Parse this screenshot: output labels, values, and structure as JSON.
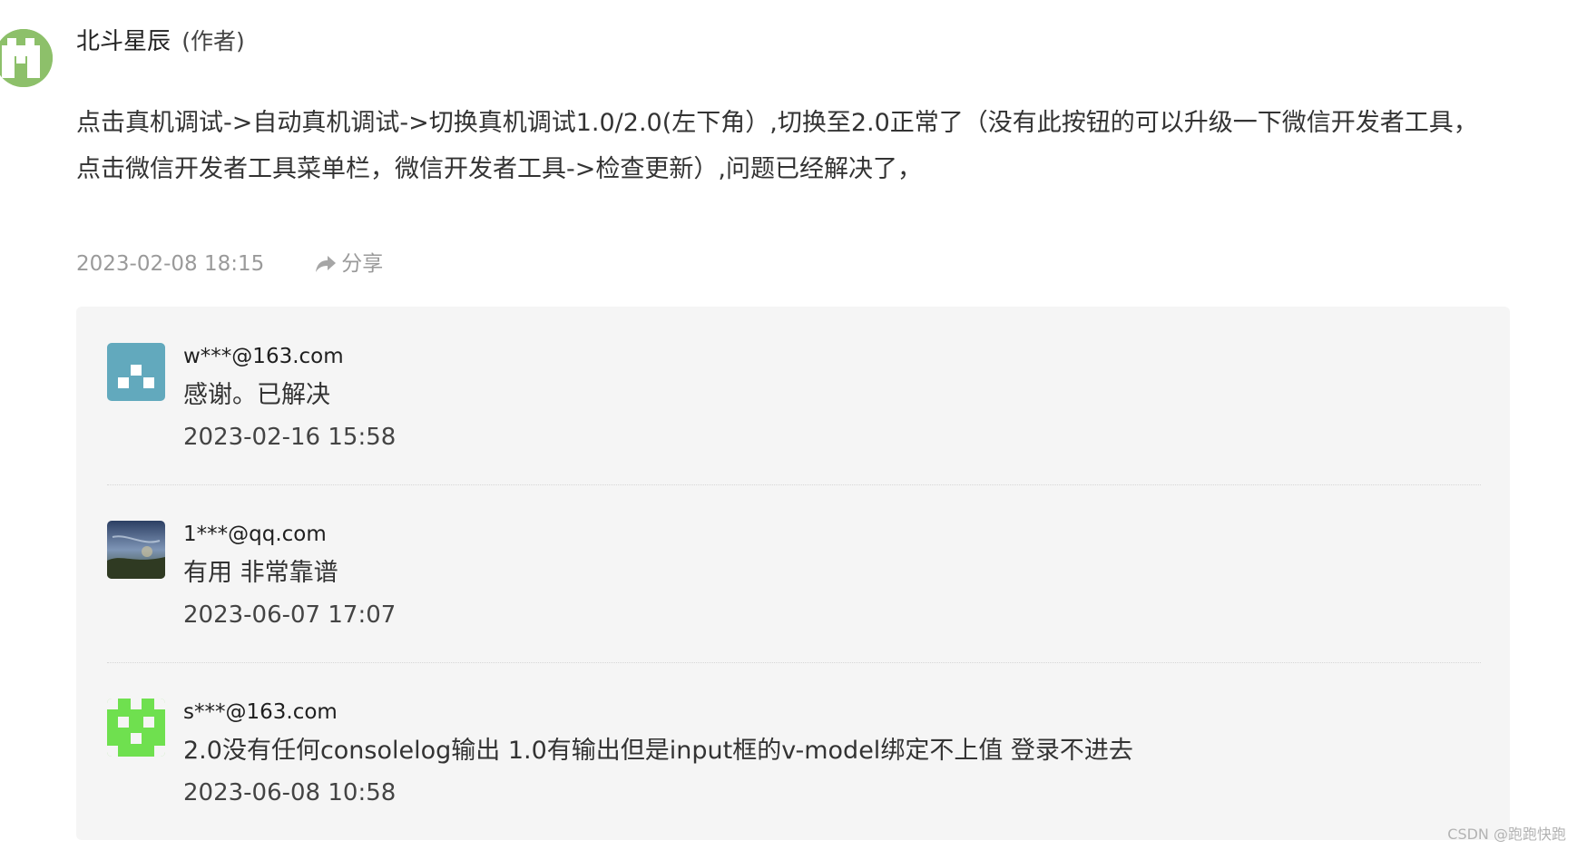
{
  "author": {
    "name": "北斗星辰",
    "tag": "(作者)",
    "avatar_icon": "author-avatar-icon",
    "avatar_color": "#8dc06a"
  },
  "post": {
    "body": "点击真机调试->自动真机调试->切换真机调试1.0/2.0(左下角）,切换至2.0正常了（没有此按钮的可以升级一下微信开发者工具，点击微信开发者工具菜单栏，微信开发者工具->检查更新）,问题已经解决了，",
    "timestamp": "2023-02-08 18:15",
    "share_label": "分享",
    "share_icon": "share-icon"
  },
  "replies": [
    {
      "user": "w***@163.com",
      "text": "感谢。已解决",
      "time": "2023-02-16 15:58",
      "avatar_icon": "identicon-avatar",
      "avatar_color": "#62a9bd"
    },
    {
      "user": "1***@qq.com",
      "text": "有用 非常靠谱",
      "time": "2023-06-07 17:07",
      "avatar_icon": "photo-avatar",
      "avatar_color": "#3d5a78"
    },
    {
      "user": "s***@163.com",
      "text": "2.0没有任何consolelog输出 1.0有输出但是input框的v-model绑定不上值 登录不进去",
      "time": "2023-06-08 10:58",
      "avatar_icon": "identicon-avatar",
      "avatar_color": "#6fe04f"
    }
  ],
  "watermark": "CSDN @跑跑快跑"
}
